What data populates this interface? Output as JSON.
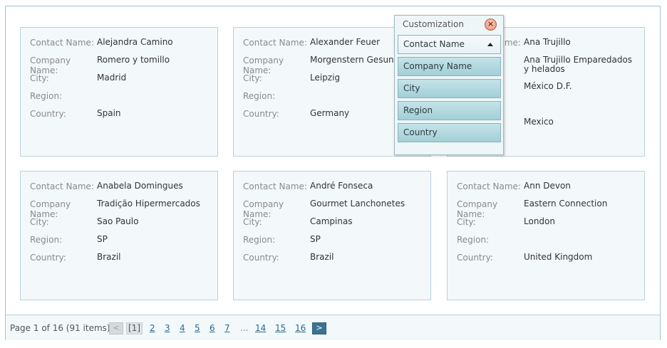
{
  "labels": {
    "contact_name": "Contact Name:",
    "company_name": "Company Name:",
    "city": "City:",
    "region": "Region:",
    "country": "Country:"
  },
  "cards": [
    {
      "contact": "Alejandra Camino",
      "company": "Romero y tomillo",
      "city": "Madrid",
      "region": "",
      "country": "Spain"
    },
    {
      "contact": "Alexander Feuer",
      "company": "Morgenstern Gesundkost",
      "city": "Leipzig",
      "region": "",
      "country": "Germany"
    },
    {
      "contact": "Ana Trujillo",
      "company": "Ana Trujillo Emparedados y helados",
      "city": "México D.F.",
      "region": "",
      "country": "Mexico"
    },
    {
      "contact": "Anabela Domingues",
      "company": "Tradição Hipermercados",
      "city": "Sao Paulo",
      "region": "SP",
      "country": "Brazil"
    },
    {
      "contact": "André Fonseca",
      "company": "Gourmet Lanchonetes",
      "city": "Campinas",
      "region": "SP",
      "country": "Brazil"
    },
    {
      "contact": "Ann Devon",
      "company": "Eastern Connection",
      "city": "London",
      "region": "",
      "country": "United Kingdom"
    }
  ],
  "customization": {
    "title": "Customization",
    "close_icon": "close-icon",
    "fields": [
      "Contact Name",
      "Company Name",
      "City",
      "Region",
      "Country"
    ],
    "sorted_field": "Contact Name",
    "sort_direction": "ascending"
  },
  "pager": {
    "summary": "Page 1 of 16 (91 items)",
    "prev_icon": "chevron-left-icon",
    "next_icon": "chevron-right-icon",
    "current_page": "[1]",
    "pages": [
      "2",
      "3",
      "4",
      "5",
      "6",
      "7"
    ],
    "ellipsis": "...",
    "last_pages": [
      "14",
      "15",
      "16"
    ]
  },
  "colors": {
    "card_bg": "#f3f8fa",
    "card_border": "#b9d2da",
    "link": "#2a6a93",
    "next_button": "#3c7293"
  }
}
